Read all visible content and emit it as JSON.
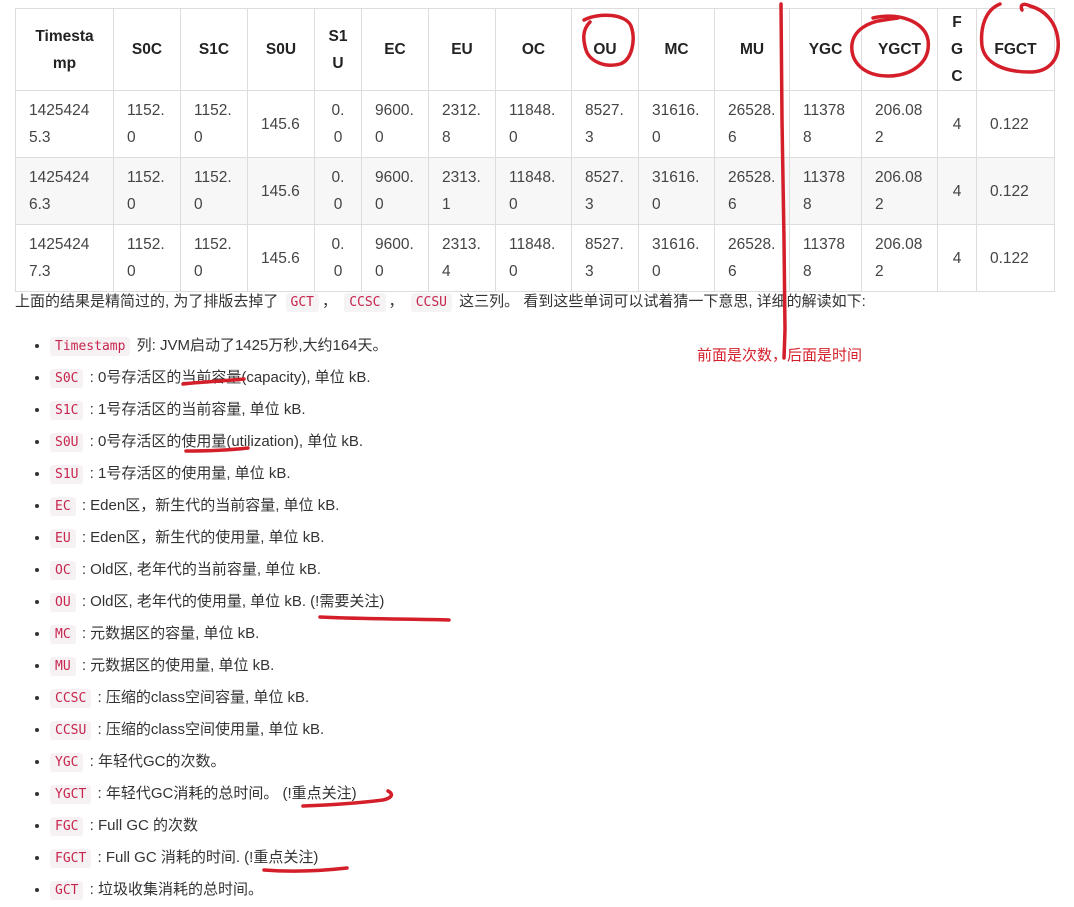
{
  "table": {
    "headers": [
      {
        "key": "timestamp",
        "text": "Timestamp"
      },
      {
        "key": "s0c",
        "text": "S0C"
      },
      {
        "key": "s1c",
        "text": "S1C"
      },
      {
        "key": "s0u",
        "text": "S0U"
      },
      {
        "key": "s1u",
        "text": "S1U"
      },
      {
        "key": "ec",
        "text": "EC"
      },
      {
        "key": "eu",
        "text": "EU"
      },
      {
        "key": "oc",
        "text": "OC"
      },
      {
        "key": "ou",
        "text": "OU"
      },
      {
        "key": "mc",
        "text": "MC"
      },
      {
        "key": "mu",
        "text": "MU"
      },
      {
        "key": "ygc",
        "text": "YGC"
      },
      {
        "key": "ygct",
        "text": "YGCT"
      },
      {
        "key": "fgc",
        "text": "FGC"
      },
      {
        "key": "fgct",
        "text": "FGCT"
      }
    ],
    "rows": [
      [
        "14254245.3",
        "1152.0",
        "1152.0",
        "145.6",
        "0.0",
        "9600.0",
        "2312.8",
        "11848.0",
        "8527.3",
        "31616.0",
        "26528.6",
        "113788",
        "206.082",
        "4",
        "0.122"
      ],
      [
        "14254246.3",
        "1152.0",
        "1152.0",
        "145.6",
        "0.0",
        "9600.0",
        "2313.1",
        "11848.0",
        "8527.3",
        "31616.0",
        "26528.6",
        "113788",
        "206.082",
        "4",
        "0.122"
      ],
      [
        "14254247.3",
        "1152.0",
        "1152.0",
        "145.6",
        "0.0",
        "9600.0",
        "2313.4",
        "11848.0",
        "8527.3",
        "31616.0",
        "26528.6",
        "113788",
        "206.082",
        "4",
        "0.122"
      ]
    ]
  },
  "intro": {
    "text_before": "上面的结果是精简过的, 为了排版去掉了",
    "code1": "GCT",
    "sep1": "，",
    "code2": "CCSC",
    "sep2": "，",
    "code3": "CCSU",
    "text_after": "这三列。 看到这些单词可以试着猜一下意思, 详细的解读如下:"
  },
  "definitions": [
    {
      "code": "Timestamp",
      "text": " 列: JVM启动了1425万秒,大约164天。"
    },
    {
      "code": "S0C",
      "text": " : 0号存活区的当前容量(capacity), 单位 kB."
    },
    {
      "code": "S1C",
      "text": " : 1号存活区的当前容量, 单位 kB."
    },
    {
      "code": "S0U",
      "text": " : 0号存活区的使用量(utilization), 单位 kB."
    },
    {
      "code": "S1U",
      "text": " : 1号存活区的使用量, 单位 kB."
    },
    {
      "code": "EC",
      "text": " : Eden区，新生代的当前容量, 单位 kB."
    },
    {
      "code": "EU",
      "text": " : Eden区，新生代的使用量, 单位 kB."
    },
    {
      "code": "OC",
      "text": " : Old区, 老年代的当前容量, 单位 kB."
    },
    {
      "code": "OU",
      "text": " : Old区, 老年代的使用量, 单位 kB.   (!需要关注)"
    },
    {
      "code": "MC",
      "text": " : 元数据区的容量, 单位 kB."
    },
    {
      "code": "MU",
      "text": " : 元数据区的使用量, 单位 kB."
    },
    {
      "code": "CCSC",
      "text": " : 压缩的class空间容量, 单位 kB."
    },
    {
      "code": "CCSU",
      "text": " : 压缩的class空间使用量, 单位 kB."
    },
    {
      "code": "YGC",
      "text": " : 年轻代GC的次数。"
    },
    {
      "code": "YGCT",
      "text": " : 年轻代GC消耗的总时间。   (!重点关注)"
    },
    {
      "code": "FGC",
      "text": " : Full GC 的次数"
    },
    {
      "code": "FGCT",
      "text": " : Full GC 消耗的时间.   (!重点关注)"
    },
    {
      "code": "GCT",
      "text": " : 垃圾收集消耗的总时间。"
    }
  ],
  "annotation": {
    "note": "前面是次数，后面是时间",
    "ink_color": "#d41f2a"
  }
}
